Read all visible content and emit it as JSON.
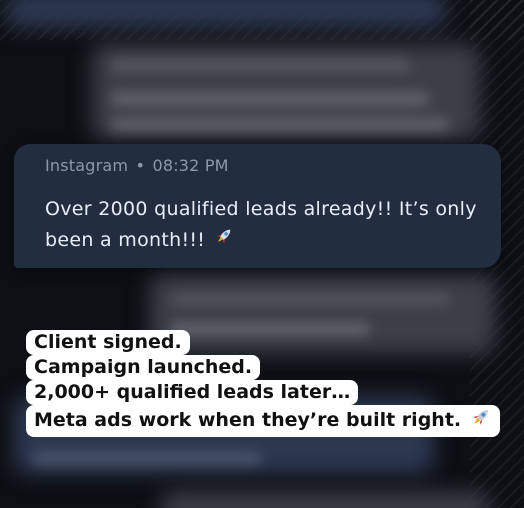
{
  "message": {
    "source": "Instagram",
    "separator": "•",
    "time": "08:32 PM",
    "text": "Over 2000 qualified leads already!! It’s only been a month!!!",
    "emoji_icon": "rocket-icon"
  },
  "caption": {
    "lines": [
      "Client signed.",
      "Campaign launched.",
      "2,000+ qualified leads later…",
      "Meta ads work when they’re built right."
    ],
    "emoji_icon": "rocket-icon"
  },
  "colors": {
    "bubble": "#222d40",
    "meta_text": "#8c98ac",
    "message_text": "#e9eef6",
    "caption_bg": "#ffffff",
    "caption_text": "#111111"
  }
}
